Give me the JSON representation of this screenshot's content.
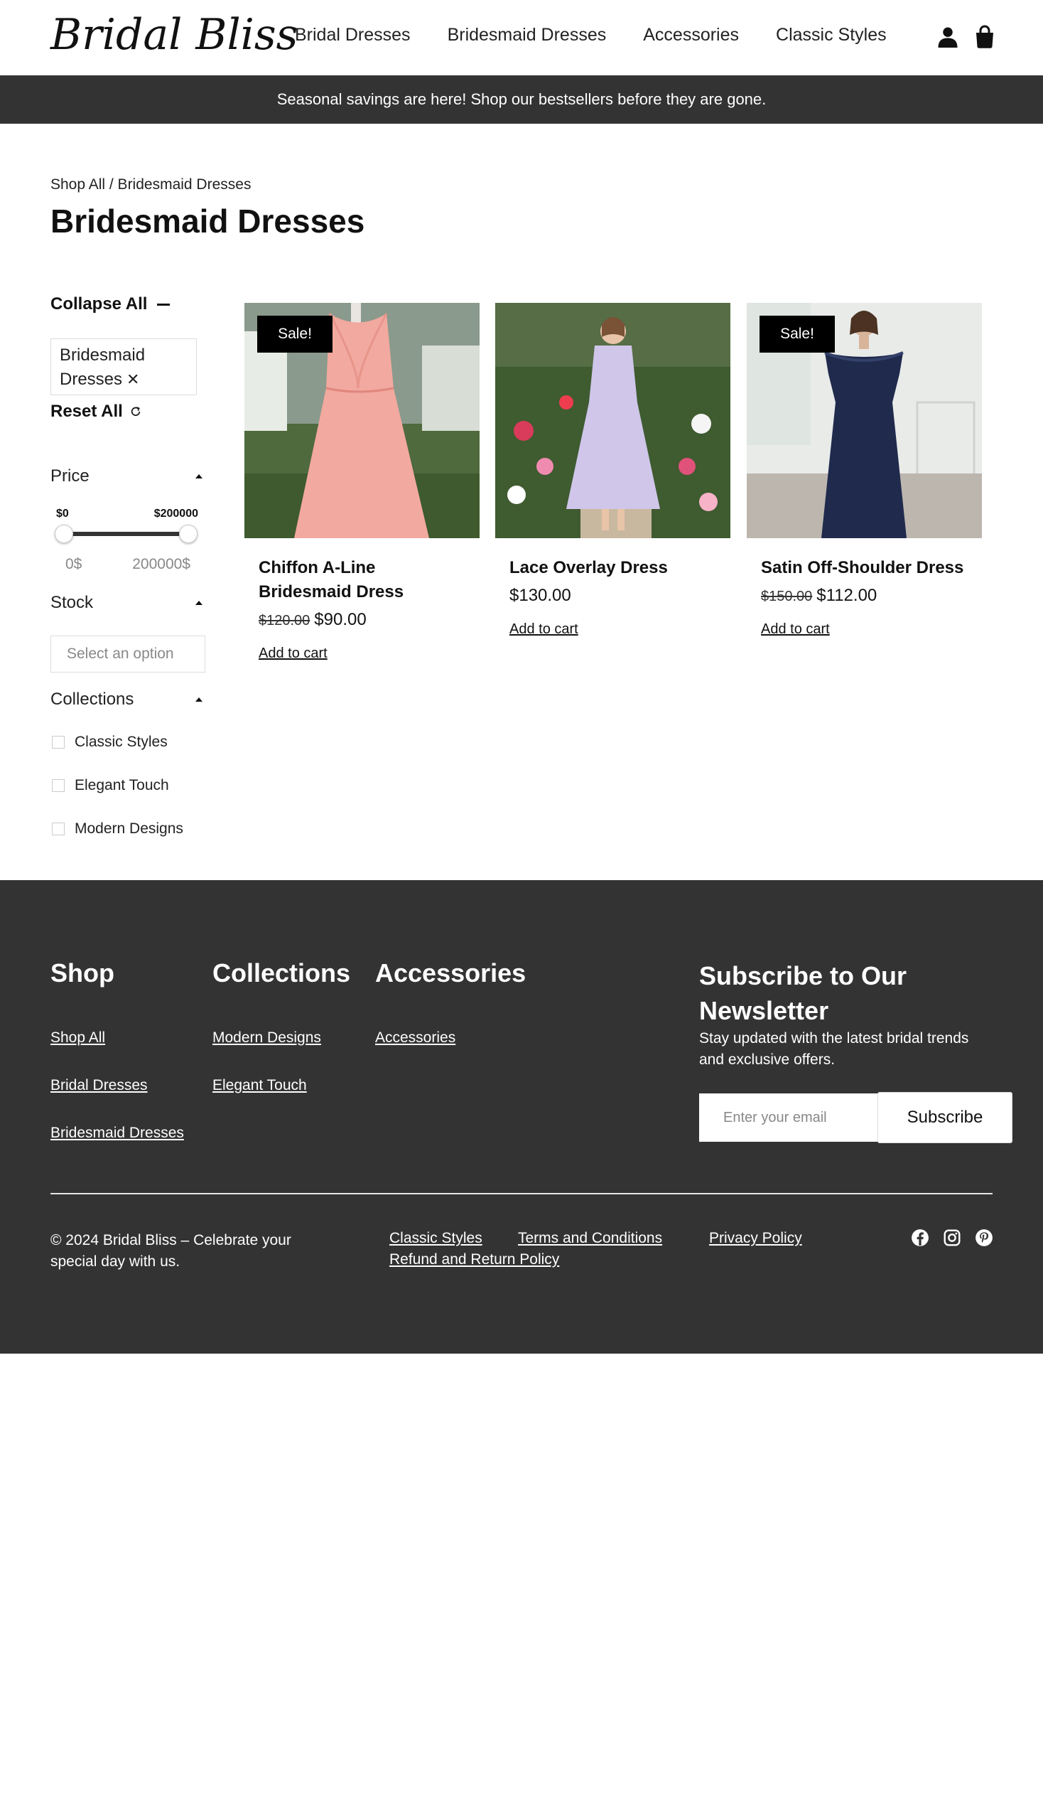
{
  "header": {
    "logo": "Bridal Bliss",
    "nav": [
      "Bridal Dresses",
      "Bridesmaid Dresses",
      "Accessories",
      "Classic Styles"
    ],
    "icons": [
      "user-icon",
      "bag-icon"
    ]
  },
  "announcement": "Seasonal savings are here! Shop our bestsellers before they are gone.",
  "breadcrumb": "Shop All / Bridesmaid Dresses",
  "page_title": "Bridesmaid Dresses",
  "sidebar": {
    "collapse_all": "Collapse All",
    "active_filter": "Bridesmaid Dresses",
    "active_filter_remove": "✕",
    "reset_all": "Reset All",
    "price": {
      "title": "Price",
      "min_label": "$0",
      "max_label": "$200000",
      "min_value": "0$",
      "max_value": "200000$"
    },
    "stock": {
      "title": "Stock",
      "placeholder": "Select an option"
    },
    "collections": {
      "title": "Collections",
      "items": [
        "Classic Styles",
        "Elegant Touch",
        "Modern Designs"
      ]
    }
  },
  "products": [
    {
      "name": "Chiffon A-Line Bridesmaid Dress",
      "sale_badge": "Sale!",
      "old_price": "$120.00",
      "price": "$90.00",
      "add_to_cart": "Add to cart",
      "dress_color": "#f2a99f"
    },
    {
      "name": "Lace Overlay Dress",
      "sale_badge": "",
      "old_price": "",
      "price": "$130.00",
      "add_to_cart": "Add to cart",
      "dress_color": "#cfc6ea"
    },
    {
      "name": "Satin Off-Shoulder Dress",
      "sale_badge": "Sale!",
      "old_price": "$150.00",
      "price": "$112.00",
      "add_to_cart": "Add to cart",
      "dress_color": "#1f2a4d"
    }
  ],
  "footer": {
    "shop": {
      "title": "Shop",
      "links": [
        "Shop All",
        "Bridal Dresses",
        "Bridesmaid Dresses"
      ]
    },
    "collections": {
      "title": "Collections",
      "links": [
        "Modern Designs",
        "Elegant Touch"
      ]
    },
    "accessories": {
      "title": "Accessories",
      "links": [
        "Accessories"
      ]
    },
    "newsletter": {
      "title": "Subscribe to Our Newsletter",
      "description": "Stay updated with the latest bridal trends and exclusive offers.",
      "placeholder": "Enter your email",
      "button": "Subscribe"
    },
    "copyright": "© 2024 Bridal Bliss – Celebrate your special day with us.",
    "legal_links": [
      "Classic Styles",
      "Terms and Conditions",
      "Privacy Policy",
      "Refund and Return Policy"
    ],
    "social": [
      "facebook-icon",
      "instagram-icon",
      "pinterest-icon"
    ]
  },
  "colors": {
    "dark_band": "#333333",
    "sale_badge": "#000000"
  }
}
